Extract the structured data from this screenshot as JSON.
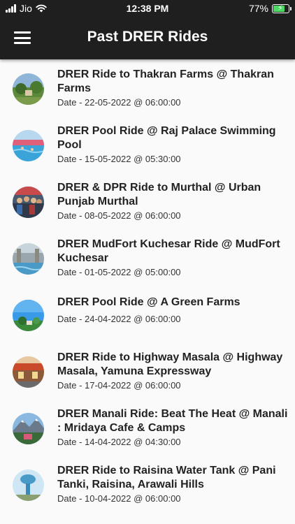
{
  "status_bar": {
    "carrier": "Jio",
    "time": "12:38 PM",
    "battery": "77%",
    "battery_level": 0.77
  },
  "header": {
    "title": "Past DRER Rides",
    "menu_icon": "hamburger-menu-icon"
  },
  "rides": [
    {
      "title": "DRER Ride to Thakran Farms  @ Thakran Farms",
      "date": "Date - 22-05-2022 @  06:00:00",
      "thumb": "farm"
    },
    {
      "title": "DRER Pool Ride  @ Raj Palace Swimming Pool",
      "date": "Date - 15-05-2022 @  05:30:00",
      "thumb": "pool"
    },
    {
      "title": "DRER & DPR Ride to Murthal  @ Urban Punjab Murthal",
      "date": "Date - 08-05-2022 @  06:00:00",
      "thumb": "group"
    },
    {
      "title": "DRER MudFort Kuchesar Ride  @ MudFort Kuchesar",
      "date": "Date - 01-05-2022 @  05:00:00",
      "thumb": "fort"
    },
    {
      "title": "DRER Pool Ride  @ A Green Farms",
      "date": "Date - 24-04-2022 @  06:00:00",
      "thumb": "sky"
    },
    {
      "title": "DRER Ride to Highway Masala  @ Highway Masala, Yamuna Expressway",
      "date": "Date - 17-04-2022 @  06:00:00",
      "thumb": "restaurant"
    },
    {
      "title": "DRER Manali Ride: Beat The Heat  @ Manali : Mridaya Cafe & Camps",
      "date": "Date - 14-04-2022 @  04:30:00",
      "thumb": "mountain"
    },
    {
      "title": "DRER Ride to Raisina Water Tank  @ Pani Tanki, Raisina, Arawali Hills",
      "date": "Date - 10-04-2022 @  06:00:00",
      "thumb": "tank"
    }
  ]
}
